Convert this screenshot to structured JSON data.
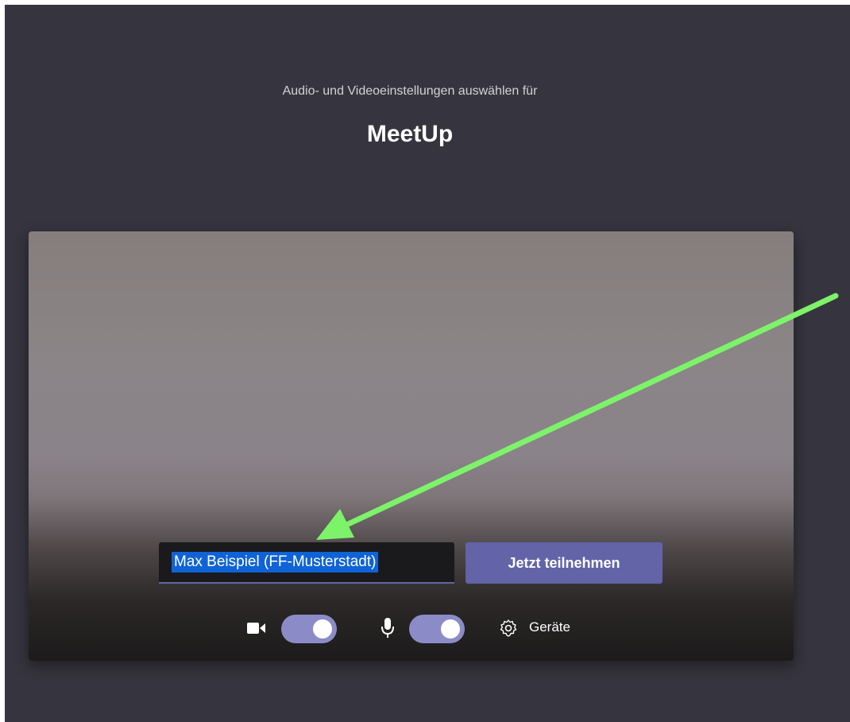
{
  "header": {
    "subtitle": "Audio- und Videoeinstellungen auswählen für",
    "meeting_title": "MeetUp"
  },
  "join": {
    "name_value": "Max Beispiel (FF-Musterstadt)",
    "join_button": "Jetzt teilnehmen"
  },
  "controls": {
    "camera_on": true,
    "microphone_on": true,
    "devices_label": "Geräte"
  },
  "colors": {
    "accent": "#6264a7",
    "toggle_on": "#8b8cc7",
    "background": "#36353f",
    "annotation_arrow": "#7df36a",
    "text_selection": "#0f63d6"
  }
}
